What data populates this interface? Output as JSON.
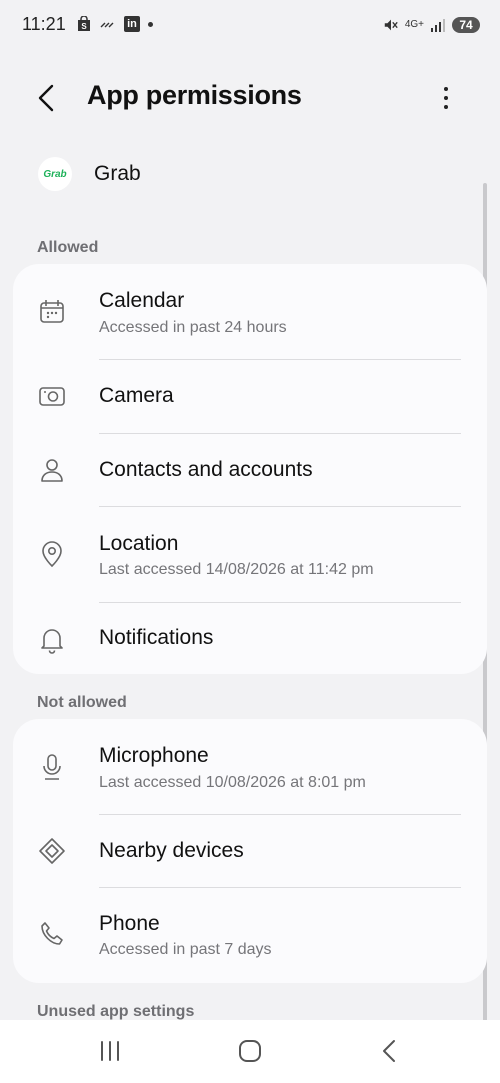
{
  "status_bar": {
    "time": "11:21",
    "network": "4G+",
    "battery": "74",
    "icons_left": [
      "shop-icon",
      "missed-call-icon",
      "linkedin-icon",
      "dot-icon"
    ],
    "icons_right": [
      "mute-icon",
      "network-4g-icon",
      "signal-icon",
      "battery-icon"
    ]
  },
  "header": {
    "title": "App permissions"
  },
  "app": {
    "name": "Grab",
    "icon_text": "Grab",
    "brand_color": "#1fb15a"
  },
  "sections": {
    "allowed": {
      "label": "Allowed",
      "items": [
        {
          "title": "Calendar",
          "subtitle": "Accessed in past 24 hours",
          "icon": "calendar-icon"
        },
        {
          "title": "Camera",
          "subtitle": "",
          "icon": "camera-icon"
        },
        {
          "title": "Contacts and accounts",
          "subtitle": "",
          "icon": "person-icon"
        },
        {
          "title": "Location",
          "subtitle": "Last accessed 14/08/2026 at 11:42 pm",
          "icon": "location-icon"
        },
        {
          "title": "Notifications",
          "subtitle": "",
          "icon": "bell-icon"
        }
      ]
    },
    "not_allowed": {
      "label": "Not allowed",
      "items": [
        {
          "title": "Microphone",
          "subtitle": "Last accessed 10/08/2026 at 8:01 pm",
          "icon": "microphone-icon"
        },
        {
          "title": "Nearby devices",
          "subtitle": "",
          "icon": "nearby-devices-icon"
        },
        {
          "title": "Phone",
          "subtitle": "Accessed in past 7 days",
          "icon": "phone-icon"
        }
      ]
    },
    "unused": {
      "label": "Unused app settings"
    }
  },
  "nav": {
    "buttons": [
      "recents-icon",
      "home-icon",
      "back-icon"
    ]
  }
}
